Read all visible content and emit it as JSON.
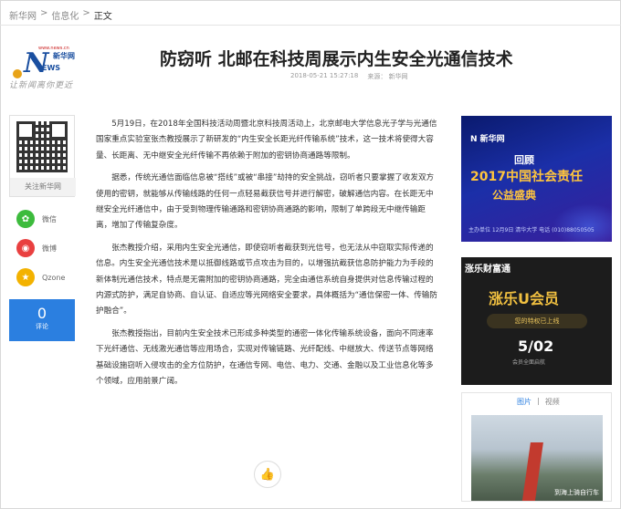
{
  "breadcrumb": {
    "home": "新华网",
    "sep": ">",
    "section": "信息化",
    "current": "正文"
  },
  "logo": {
    "n": "N",
    "ews": "EWS",
    "xh": "新华网",
    "url": "www.news.cn",
    "slogan": "让新闻离你更近"
  },
  "article": {
    "title": "防窃听 北邮在科技周展示内生安全光通信技术",
    "time": "2018-05-21 15:27:18",
    "source": "来源： 新华网",
    "paragraphs": [
      "5月19日，在2018年全国科技活动周暨北京科技周活动上，北京邮电大学信息光子学与光通信国家重点实验室张杰教授展示了新研发的“内生安全长距光纤传输系统”技术，这一技术将使得大容量、长距离、无中继安全光纤传输不再依赖于附加的密钥协商通路等限制。",
      "据悉，传统光通信面临信息被“搭线”或被“串接”劫持的安全挑战，窃听者只要掌握了收发双方使用的密钥，就能够从传输线路的任何一点轻易截获信号并进行解密，破解通信内容。在长距无中继安全光纤通信中，由于受到物理传输通路和密钥协商通路的影响，限制了单跨段无中继传输距离，增加了传输复杂度。",
      "张杰教授介绍，采用内生安全光通信，即使窃听者截获到光信号，也无法从中窃取实际传递的信息。内生安全光通信技术是以抵御线路或节点攻击为目的，以增强抗截获信息防护能力为手段的新体制光通信技术，特点是无需附加的密钥协商通路，完全由通信系统自身提供对信息传输过程的内源式防护，满足自协商、自认证、自适应等光网络安全要求，具体概括为“通信保密一体、传输防护融合”。",
      "张杰教授指出，目前内生安全技术已形成多种类型的通密一体化传输系统设备，面向不同速率下光纤通信、无线激光通信等应用场合，实现对传输链路、光纤配线、中继放大、传送节点等网络基础设施窃听入侵攻击的全方位防护，在通信专网、电信、电力、交通、金融以及工业信息化等多个领域，应用前景广阔。"
    ]
  },
  "sidebar": {
    "qr_label": "关注新华网",
    "share_wechat": "微信",
    "share_weibo": "微博",
    "share_qzone": "Qzone",
    "comment_count": "0",
    "comment_label": "评论"
  },
  "ads": {
    "ad1": {
      "brand": "N 新华网",
      "huigu": "回顾",
      "headline": "2017中国社会责任",
      "sub": "公益盛典",
      "meta": "主办单位 12月9日 清华大学 电话 (010)88050505"
    },
    "ad2": {
      "brand": "涨乐财富通",
      "logo": "涨乐U会员",
      "pill": "您的特权已上线",
      "date": "5/02",
      "tag": "会员全面启航"
    }
  },
  "media": {
    "tab_photo": "图片",
    "tab_sep": "|",
    "tab_video": "视频",
    "caption": "到海上骑自行车"
  },
  "colors": {
    "accent": "#2b7fe0",
    "wechat": "#3dbb3d",
    "weibo": "#e94040",
    "qzone": "#f3b200"
  }
}
